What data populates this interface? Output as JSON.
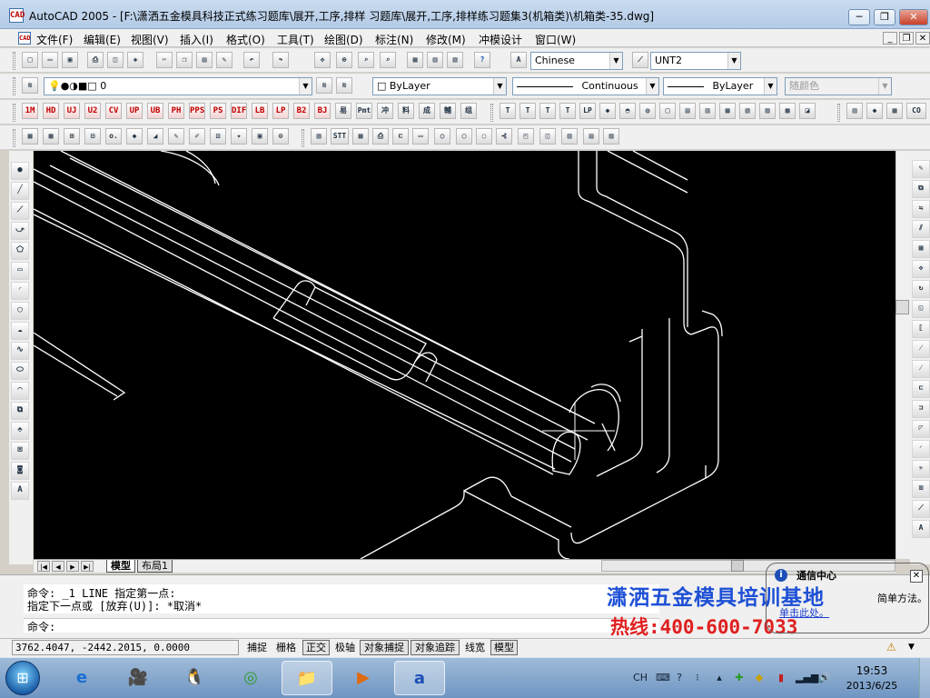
{
  "window": {
    "title": "AutoCAD 2005 - [F:\\潇洒五金模具科技正式练习题库\\展开,工序,排样 习题库\\展开,工序,排样练习题集3(机箱类)\\机箱类-35.dwg]",
    "app_icon": "CAD",
    "controls": {
      "minimize": "─",
      "restore": "❐",
      "close": "✕"
    }
  },
  "menubar": {
    "items": [
      "文件(F)",
      "编辑(E)",
      "视图(V)",
      "插入(I)",
      "格式(O)",
      "工具(T)",
      "绘图(D)",
      "标注(N)",
      "修改(M)",
      "冲模设计",
      "窗口(W)"
    ],
    "doc_controls": {
      "minimize": "_",
      "restore": "❐",
      "close": "✕"
    }
  },
  "toolbar_standard": {
    "text_style": "Chinese",
    "dim_style": "UNT2"
  },
  "toolbar_layers": {
    "layer_name": "0",
    "color": "ByLayer",
    "linetype": "Continuous",
    "lineweight": "ByLayer",
    "plot_style": "随颜色"
  },
  "toolbar_custom": {
    "labels": [
      "1M",
      "HD",
      "UJ",
      "U2",
      "CV",
      "UP",
      "UB",
      "PH",
      "PPS",
      "PS",
      "DIF",
      "LB",
      "LP",
      "B2",
      "BJ",
      "易",
      "Pmt",
      "冲",
      "料",
      "成",
      "輔",
      "组"
    ],
    "right_label": "CO"
  },
  "toolbar_draw2": {
    "stt_label": "STT"
  },
  "layout_tabs": {
    "model": "模型",
    "layout1": "布局1"
  },
  "command": {
    "history": [
      "命令: _1 LINE 指定第一点:",
      "指定下一点或 [放弃(U)]: *取消*"
    ],
    "prompt": "命令:"
  },
  "promo": {
    "title": "潇洒五金模具培训基地",
    "phone": "热线:400-600-7033"
  },
  "balloon": {
    "title": "通信中心",
    "text": "简单方法。",
    "link": "单击此处。"
  },
  "statusbar": {
    "coords": "3762.4047, -2442.2015, 0.0000",
    "toggles": [
      {
        "label": "捕捉",
        "on": false
      },
      {
        "label": "栅格",
        "on": false
      },
      {
        "label": "正交",
        "on": true
      },
      {
        "label": "极轴",
        "on": false
      },
      {
        "label": "对象捕捉",
        "on": true
      },
      {
        "label": "对象追踪",
        "on": true
      },
      {
        "label": "线宽",
        "on": false
      },
      {
        "label": "模型",
        "on": true
      }
    ]
  },
  "taskbar": {
    "tray": {
      "lang": "CH",
      "time": "19:53",
      "date": "2013/6/25"
    }
  },
  "colors": {
    "canvas_bg": "#000000",
    "drawing_lines": "#ffffff",
    "promo_blue": "#1e50d6",
    "promo_red": "#e02020"
  }
}
